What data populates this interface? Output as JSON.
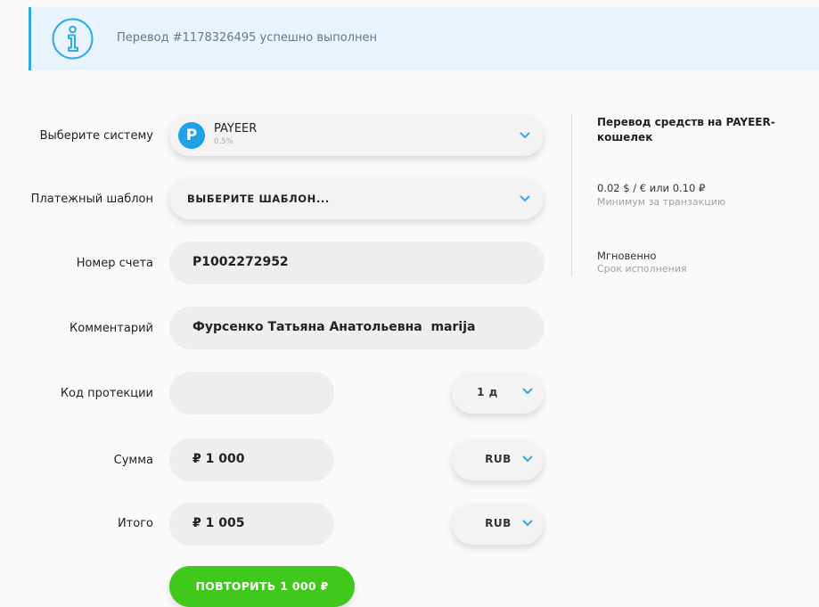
{
  "notice": {
    "text": "Перевод #1178326495 успешно выполнен",
    "icon": "info-icon"
  },
  "form": {
    "system": {
      "label": "Выберите систему",
      "name": "PAYEER",
      "fee": "0.5%",
      "logo_letter": "P",
      "logo_color": "#1fa1e6"
    },
    "template": {
      "label": "Платежный шаблон",
      "value": "ВЫБЕРИТЕ ШАБЛОН..."
    },
    "account": {
      "label": "Номер счета",
      "value": "P1002272952"
    },
    "comment": {
      "label": "Комментарий",
      "value": "Фурсенко Татьяна Анатольевна  marija"
    },
    "protection": {
      "label": "Код протекции",
      "value": "",
      "period": "1 д"
    },
    "amount": {
      "label": "Сумма",
      "value": "₽ 1 000",
      "currency": "RUB"
    },
    "total": {
      "label": "Итого",
      "value": "₽ 1 005",
      "currency": "RUB"
    },
    "submit_label": "ПОВТОРИТЬ 1 000 ₽"
  },
  "sidebar": {
    "title": "Перевод средств на PAYEER-кошелек",
    "min_value": "0.02 $ / € или 0.10 ₽",
    "min_label": "Минимум за транзакцию",
    "time_value": "Мгновенно",
    "time_label": "Срок исполнения"
  },
  "colors": {
    "accent": "#2fa8e6",
    "button": "#40c81c",
    "notice_bg": "#e8f3fb"
  }
}
